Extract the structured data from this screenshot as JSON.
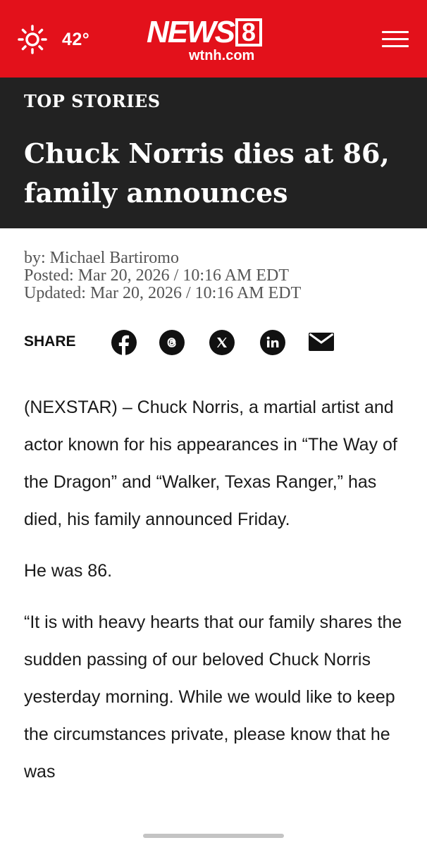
{
  "header": {
    "temperature": "42°",
    "weather_icon": "sun-icon",
    "logo_word": "NEWS",
    "logo_number": "8",
    "logo_domain": "wtnh.com",
    "menu_icon": "hamburger-menu-icon",
    "brand_color": "#e3111b"
  },
  "title_band": {
    "section": "TOP STORIES",
    "headline": "Chuck Norris dies at 86, family announces",
    "background_color": "#222222"
  },
  "byline": {
    "author": "by: Michael Bartiromo",
    "posted": "Posted: Mar 20, 2026 / 10:16 AM EDT",
    "updated": "Updated: Mar 20, 2026 / 10:16 AM EDT"
  },
  "share": {
    "label": "SHARE",
    "icons": [
      "facebook-icon",
      "threads-icon",
      "x-icon",
      "linkedin-icon",
      "email-icon"
    ]
  },
  "article": {
    "paragraphs": [
      "(NEXSTAR) – Chuck Norris, a martial artist and actor known for his appearances in “The Way of the Dragon” and “Walker, Texas Ranger,” has died, his family announced Friday.",
      "He was 86.",
      "“It is with heavy hearts that our family shares the sudden passing of our beloved Chuck Norris yesterday morning. While we would like to keep the circumstances private, please know that he was"
    ]
  }
}
